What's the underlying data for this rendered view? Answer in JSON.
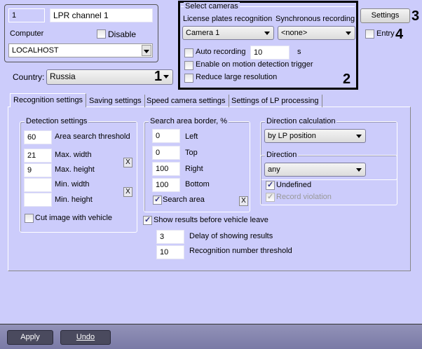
{
  "channel": {
    "id": "1",
    "name": "LPR channel 1",
    "computer_label": "Computer",
    "disable_label": "Disable",
    "computer_value": "LOCALHOST",
    "disable_checked": false
  },
  "country": {
    "label": "Country:",
    "value": "Russia"
  },
  "callouts": {
    "c1": "1",
    "c2": "2",
    "c3": "3",
    "c4": "4"
  },
  "cameras": {
    "title": "Select cameras",
    "lpr_label": "License plates recognition",
    "sync_label": "Synchronous recording",
    "lpr_value": "Camera 1",
    "sync_value": "<none>",
    "auto_label": "Auto recording",
    "auto_value": "10",
    "auto_unit": "s",
    "motion_label": "Enable on motion detection trigger",
    "reduce_label": "Reduce large resolution"
  },
  "settings_button": "Settings",
  "entry_label": "Entry",
  "tabs": [
    "Recognition settings",
    "Saving settings",
    "Speed camera settings",
    "Settings of LP processing"
  ],
  "detection": {
    "title": "Detection settings",
    "area_value": "60",
    "area_label": "Area search threshold",
    "maxw_value": "21",
    "maxw_label": "Max. width",
    "maxh_value": "9",
    "maxh_label": "Max. height",
    "minw_value": "",
    "minw_label": "Min. width",
    "minh_value": "",
    "minh_label": "Min. height",
    "clear": "X",
    "cut_label": "Cut image with vehicle"
  },
  "search": {
    "title": "Search area border, %",
    "left": "0",
    "left_label": "Left",
    "top": "0",
    "top_label": "Top",
    "right": "100",
    "right_label": "Right",
    "bottom": "100",
    "bottom_label": "Bottom",
    "area_label": "Search area",
    "clear": "X"
  },
  "show": {
    "label": "Show results before vehicle leave",
    "delay_value": "3",
    "delay_label": "Delay of showing results",
    "thr_value": "10",
    "thr_label": "Recognition number threshold"
  },
  "dircalc": {
    "title": "Direction calculation",
    "value": "by LP position"
  },
  "direction": {
    "title": "Direction",
    "value": "any",
    "undefined_label": "Undefined",
    "record_label": "Record violation"
  },
  "footer": {
    "apply": "Apply",
    "undo": "Undo"
  }
}
